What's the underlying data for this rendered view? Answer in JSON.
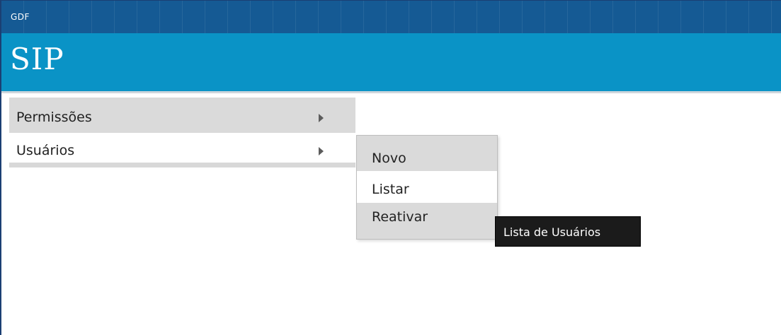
{
  "header": {
    "org_label": "GDF",
    "app_title": "SIP"
  },
  "menu": {
    "items": [
      {
        "label": "Permissões",
        "has_submenu": true
      },
      {
        "label": "Usuários",
        "has_submenu": true
      }
    ]
  },
  "submenu": {
    "parent": "Usuários",
    "items": [
      {
        "label": "Novo"
      },
      {
        "label": "Listar"
      },
      {
        "label": "Reativar"
      }
    ]
  },
  "tooltip": {
    "text": "Lista de Usuários"
  },
  "colors": {
    "top_bar": "#155a94",
    "brand_bar": "#0a93c6",
    "menu_highlight": "#dadada",
    "tooltip_bg": "#1b1b1b"
  }
}
